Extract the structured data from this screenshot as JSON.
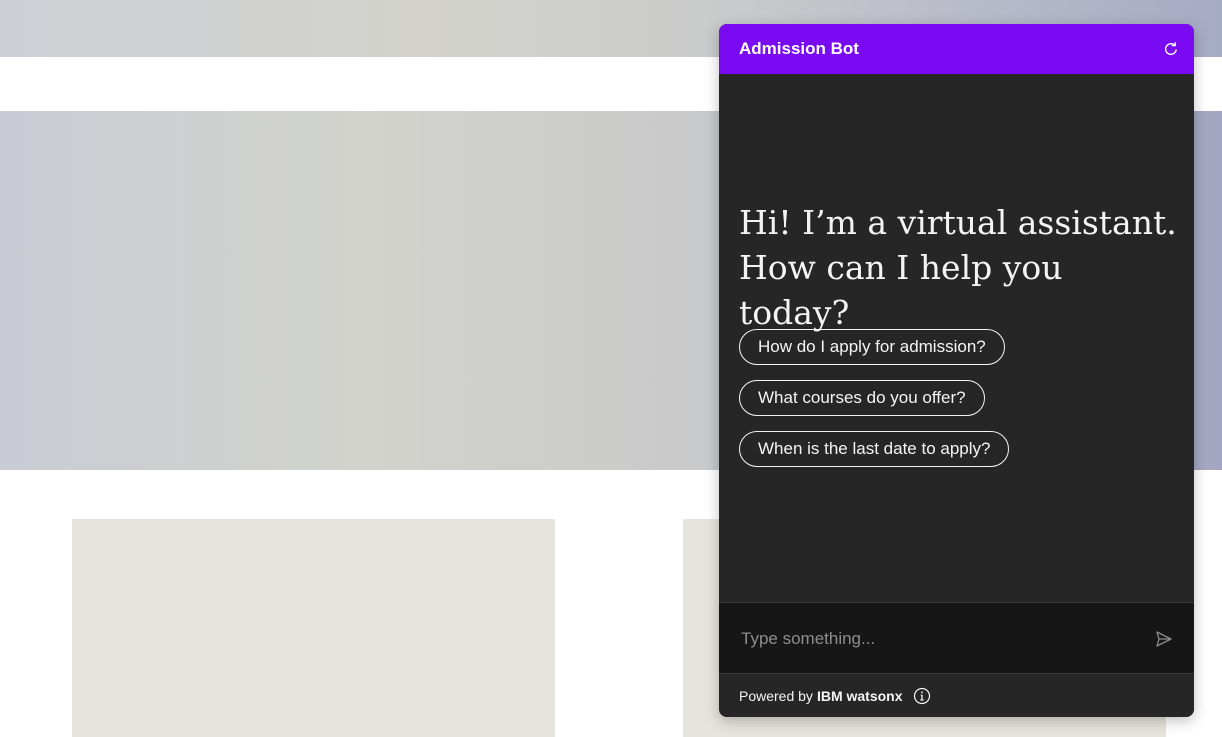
{
  "chat": {
    "title": "Admission Bot",
    "header_color": "#7a0af2",
    "greeting_line1": "Hi! I’m a virtual assistant.",
    "greeting_line2": "How can I help you today?",
    "suggestions": [
      "How do I apply for admission?",
      "What courses do you offer?",
      "When is the last date to apply?"
    ],
    "input_placeholder": "Type something...",
    "footer_prefix": "Powered by",
    "footer_brand": "IBM watsonx",
    "icons": {
      "restart": "restart-icon",
      "send": "send-icon",
      "info": "info-icon"
    }
  }
}
